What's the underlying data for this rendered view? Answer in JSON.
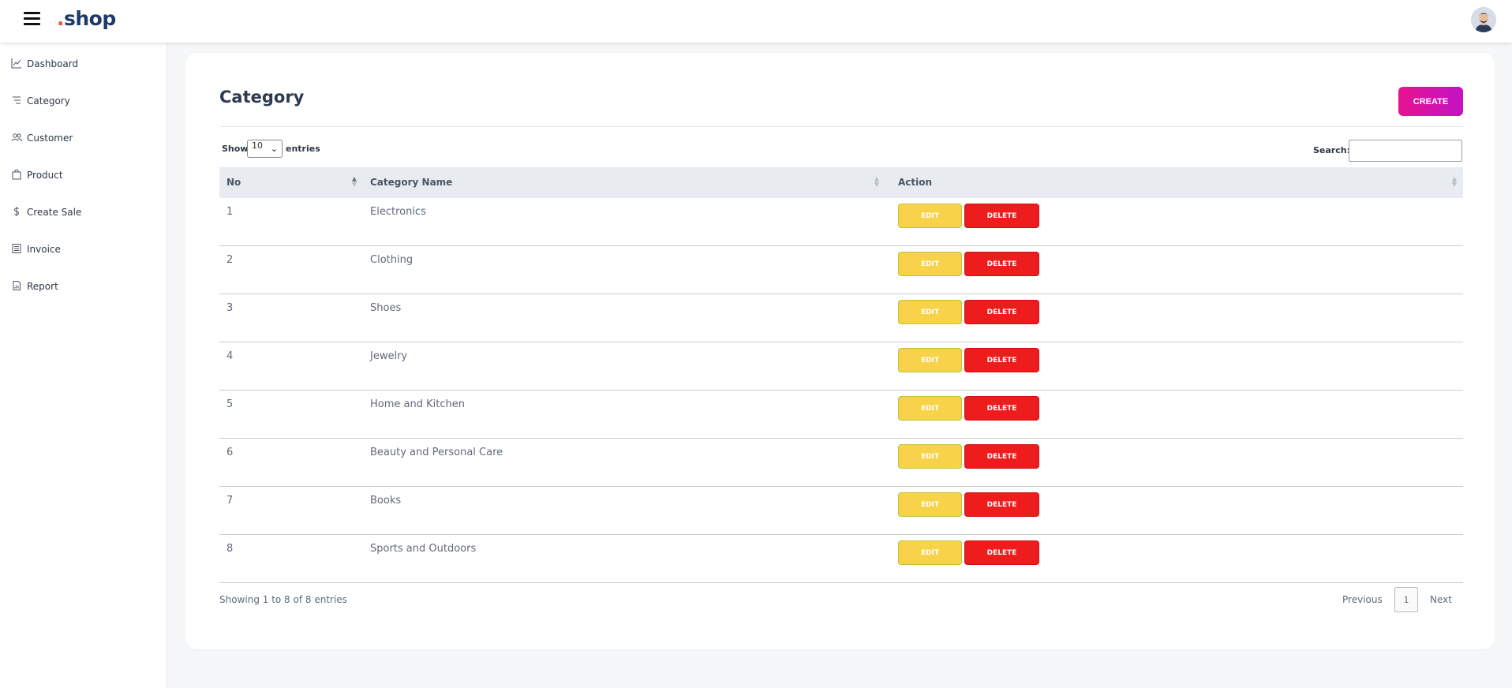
{
  "brand": {
    "logo_dot": ".",
    "logo_text": "shop"
  },
  "sidebar": {
    "items": [
      {
        "label": "Dashboard",
        "icon": "line-chart-icon"
      },
      {
        "label": "Category",
        "icon": "list-icon"
      },
      {
        "label": "Customer",
        "icon": "users-icon"
      },
      {
        "label": "Product",
        "icon": "bag-icon"
      },
      {
        "label": "Create Sale",
        "icon": "dollar-icon"
      },
      {
        "label": "Invoice",
        "icon": "receipt-icon"
      },
      {
        "label": "Report",
        "icon": "report-icon"
      }
    ]
  },
  "main": {
    "title": "Category",
    "create_label": "CREATE",
    "show_label": "Show",
    "entries_value": "10",
    "entries_label": "entries",
    "search_label": "Search:",
    "search_value": "",
    "columns": [
      "No",
      "Category Name",
      "Action"
    ],
    "rows": [
      {
        "no": "1",
        "name": "Electronics"
      },
      {
        "no": "2",
        "name": "Clothing"
      },
      {
        "no": "3",
        "name": "Shoes"
      },
      {
        "no": "4",
        "name": "Jewelry"
      },
      {
        "no": "5",
        "name": "Home and Kitchen"
      },
      {
        "no": "6",
        "name": "Beauty and Personal Care"
      },
      {
        "no": "7",
        "name": "Books"
      },
      {
        "no": "8",
        "name": "Sports and Outdoors"
      }
    ],
    "edit_label": "EDIT",
    "delete_label": "DELETE",
    "info": "Showing 1 to 8 of 8 entries",
    "pagination": {
      "previous": "Previous",
      "current": "1",
      "next": "Next"
    }
  },
  "colors": {
    "accent_gradient_start": "#e6138f",
    "accent_gradient_end": "#c313c4",
    "edit_button": "#f8d34a",
    "delete_button": "#ee1c1c",
    "logo_dot": "#f15a24",
    "logo_text": "#1e3a6b"
  }
}
